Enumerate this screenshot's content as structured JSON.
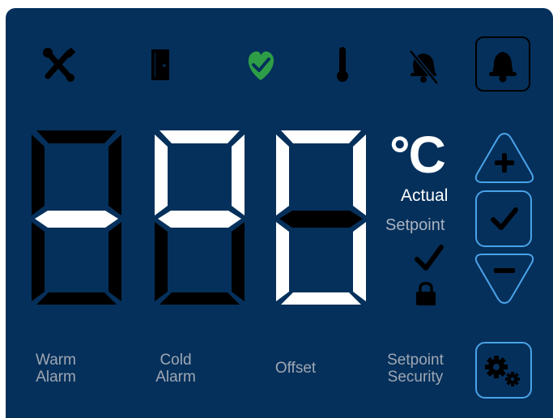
{
  "status_icons": [
    {
      "name": "service-tools-icon",
      "active": false
    },
    {
      "name": "door-icon",
      "active": false
    },
    {
      "name": "status-ok-heart-icon",
      "active": true
    },
    {
      "name": "thermometer-icon",
      "active": false
    },
    {
      "name": "alarm-muted-icon",
      "active": false
    },
    {
      "name": "alarm-bell-icon",
      "active": false
    }
  ],
  "colors": {
    "panel": "#05305b",
    "segment_on": "#ffffff",
    "segment_off": "#000000",
    "ok_green": "#2e9e46",
    "button_outline": "#4aa3e8",
    "label_dim": "#aab3c0"
  },
  "display": {
    "unit": "°C",
    "actual_label": "Actual",
    "setpoint_label": "Setpoint",
    "digits": [
      {
        "position": 1,
        "lit_segments": [
          "g"
        ]
      },
      {
        "position": 2,
        "lit_segments": [
          "a",
          "f",
          "b",
          "g"
        ]
      },
      {
        "position": 3,
        "lit_segments": [
          "a",
          "b",
          "c",
          "d",
          "e",
          "f"
        ]
      }
    ]
  },
  "controls": {
    "increase": "plus-icon",
    "confirm": "check-icon",
    "decrease": "minus-icon",
    "settings": "settings-gears-icon"
  },
  "indicators": {
    "confirmed": "check-icon",
    "locked": "lock-icon"
  },
  "bottom_labels": {
    "warm_alarm": {
      "line1": "Warm",
      "line2": "Alarm"
    },
    "cold_alarm": {
      "line1": "Cold",
      "line2": "Alarm"
    },
    "offset": {
      "line1": "Offset"
    },
    "setpoint_security": {
      "line1": "Setpoint",
      "line2": "Security"
    }
  }
}
